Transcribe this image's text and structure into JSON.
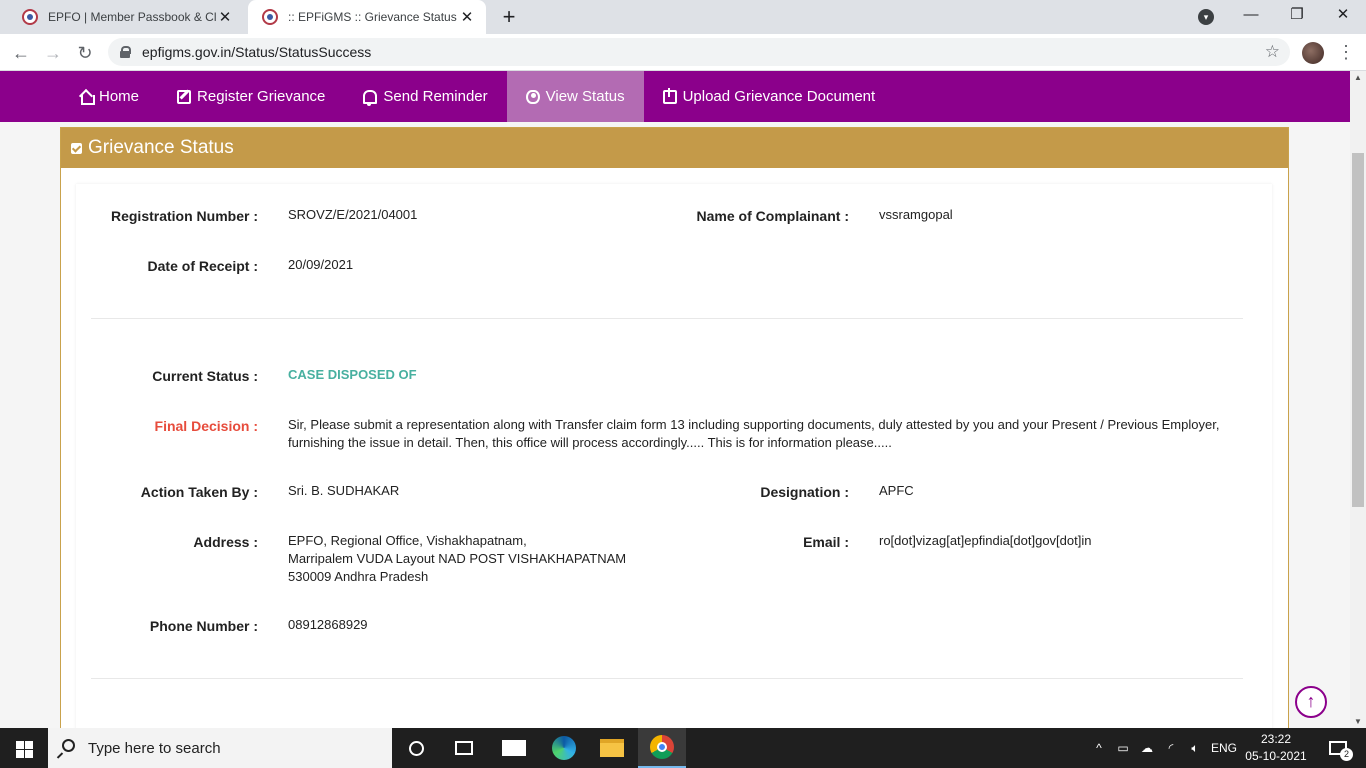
{
  "browser": {
    "tabs": [
      {
        "title": "EPFO | Member Passbook & Claim",
        "active": false
      },
      {
        "title": ":: EPFiGMS :: Grievance Status",
        "active": true
      }
    ],
    "url": "epfigms.gov.in/Status/StatusSuccess"
  },
  "navbar": {
    "items": [
      {
        "label": "Home",
        "icon": "home-icon"
      },
      {
        "label": "Register Grievance",
        "icon": "edit-icon"
      },
      {
        "label": "Send Reminder",
        "icon": "bell-icon"
      },
      {
        "label": "View Status",
        "icon": "eye-icon",
        "active": true
      },
      {
        "label": "Upload Grievance Document",
        "icon": "upload-icon"
      }
    ],
    "bg_color": "#8b008b"
  },
  "panel": {
    "title": "Grievance Status",
    "header_color": "#c49a49"
  },
  "grievance": {
    "registration_number_label": "Registration Number :",
    "registration_number": "SROVZ/E/2021/04001",
    "complainant_label": "Name of Complainant :",
    "complainant": "vssramgopal",
    "receipt_date_label": "Date of Receipt :",
    "receipt_date": "20/09/2021",
    "current_status_label": "Current Status :",
    "current_status": "CASE DISPOSED OF",
    "final_decision_label": "Final Decision :",
    "final_decision": "Sir, Please submit a representation along with Transfer claim form 13 including supporting documents, duly attested by you and your Present / Previous Employer, furnishing the issue in detail. Then, this office will process accordingly..... This is for information please.....",
    "action_taken_by_label": "Action Taken By :",
    "action_taken_by": "Sri. B. SUDHAKAR",
    "designation_label": "Designation :",
    "designation": "APFC",
    "address_label": "Address :",
    "address_lines": [
      "EPFO, Regional Office, Vishakhapatnam,",
      "Marripalem VUDA Layout NAD POST VISHAKHAPATNAM",
      "530009 Andhra Pradesh"
    ],
    "email_label": "Email :",
    "email": "ro[dot]vizag[at]epfindia[dot]gov[dot]in",
    "phone_label": "Phone Number :",
    "phone": "08912868929"
  },
  "taskbar": {
    "search_placeholder": "Type here to search",
    "language": "ENG",
    "time": "23:22",
    "date": "05-10-2021",
    "notifications": "2"
  }
}
